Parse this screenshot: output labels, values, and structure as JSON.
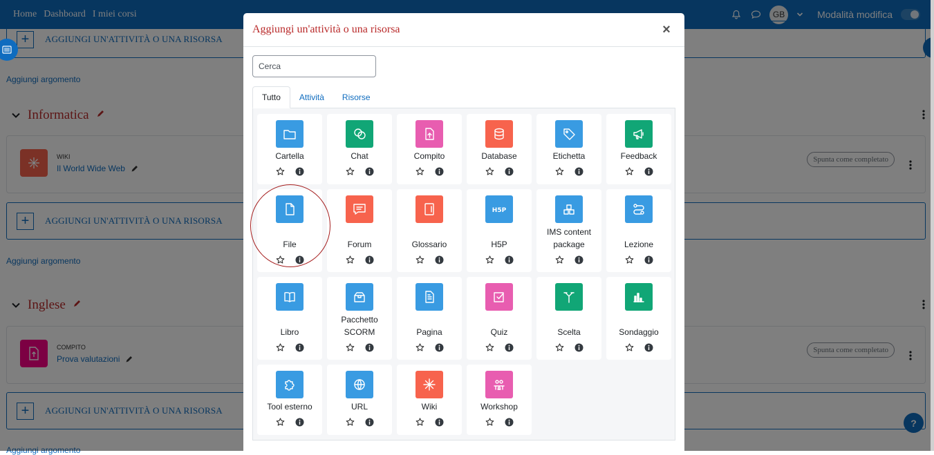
{
  "navbar": {
    "links": [
      "Home",
      "Dashboard",
      "I miei corsi"
    ],
    "avatar_initials": "GB",
    "edit_mode_label": "Modalità modifica"
  },
  "page": {
    "add_activity_label": "AGGIUNGI UN'ATTIVITÀ O UNA RISORSA",
    "add_topic_label": "Aggiungi argomento",
    "sections": [
      {
        "name": "Informatica",
        "activity": {
          "type": "WIKI",
          "name": "Il World Wide Web",
          "completion": "Spunta come completato",
          "color": "#f7634d"
        }
      },
      {
        "name": "Inglese",
        "activity": {
          "type": "COMPITO",
          "name": "Prova valutazioni",
          "completion": "Spunta come completato",
          "color": "#f90086"
        }
      }
    ],
    "help_label": "?"
  },
  "modal": {
    "title": "Aggiungi un'attività o una risorsa",
    "close_label": "×",
    "search_placeholder": "Cerca",
    "tabs": [
      {
        "label": "Tutto",
        "active": true
      },
      {
        "label": "Attività",
        "active": false
      },
      {
        "label": "Risorse",
        "active": false
      }
    ],
    "items": [
      {
        "label": "Cartella",
        "icon": "folder-icon",
        "color": "#399be2"
      },
      {
        "label": "Chat",
        "icon": "chat-icon",
        "color": "#11a676"
      },
      {
        "label": "Compito",
        "icon": "assignment-icon",
        "color": "#e85db0"
      },
      {
        "label": "Database",
        "icon": "database-icon",
        "color": "#f7634d"
      },
      {
        "label": "Etichetta",
        "icon": "tag-icon",
        "color": "#399be2"
      },
      {
        "label": "Feedback",
        "icon": "megaphone-icon",
        "color": "#11a676"
      },
      {
        "label": "File",
        "icon": "file-icon",
        "color": "#399be2"
      },
      {
        "label": "Forum",
        "icon": "forum-icon",
        "color": "#f7634d"
      },
      {
        "label": "Glossario",
        "icon": "glossary-icon",
        "color": "#f7634d"
      },
      {
        "label": "H5P",
        "icon": "h5p-icon",
        "color": "#399be2"
      },
      {
        "label": "IMS content package",
        "icon": "package-icon",
        "color": "#399be2"
      },
      {
        "label": "Lezione",
        "icon": "lesson-icon",
        "color": "#399be2"
      },
      {
        "label": "Libro",
        "icon": "book-icon",
        "color": "#399be2"
      },
      {
        "label": "Pacchetto SCORM",
        "icon": "scorm-icon",
        "color": "#399be2"
      },
      {
        "label": "Pagina",
        "icon": "page-icon",
        "color": "#399be2"
      },
      {
        "label": "Quiz",
        "icon": "quiz-icon",
        "color": "#e85db0"
      },
      {
        "label": "Scelta",
        "icon": "choice-icon",
        "color": "#11a676"
      },
      {
        "label": "Sondaggio",
        "icon": "survey-icon",
        "color": "#11a676"
      },
      {
        "label": "Tool esterno",
        "icon": "puzzle-icon",
        "color": "#399be2"
      },
      {
        "label": "URL",
        "icon": "globe-icon",
        "color": "#399be2"
      },
      {
        "label": "Wiki",
        "icon": "wiki-icon",
        "color": "#f7634d"
      },
      {
        "label": "Workshop",
        "icon": "workshop-icon",
        "color": "#e85db0"
      }
    ]
  },
  "colors": {
    "brand": "#0f6cbf",
    "section_title": "#b92a2a",
    "highlight": "#a51d1d"
  }
}
